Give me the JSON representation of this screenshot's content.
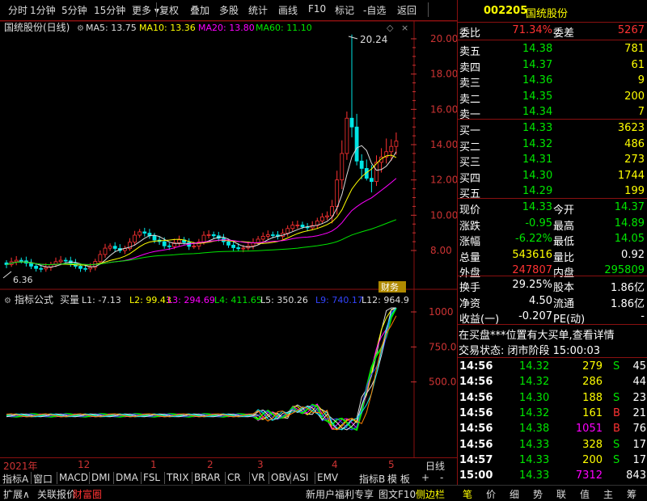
{
  "toolbar": {
    "items": [
      "分时",
      "1分钟",
      "5分钟",
      "15分钟",
      "更多",
      "复权",
      "叠加",
      "多股",
      "统计",
      "画线",
      "F10",
      "标记",
      "-自选",
      "返回"
    ]
  },
  "stock": {
    "code": "002205",
    "name": "国统股份",
    "chart_title": "国统股份(日线)"
  },
  "ma": {
    "ma5": "MA5: 13.75",
    "ma10": "MA10: 13.36",
    "ma20": "MA20: 13.80",
    "ma60": "MA60: 11.10"
  },
  "price_axis": [
    "20.00",
    "18.00",
    "16.00",
    "14.00",
    "12.00",
    "10.00",
    "8.00"
  ],
  "high_label": "20.24",
  "low_label": "6.36",
  "badge": "财务",
  "ind_badge": "模",
  "indicator": {
    "name": "指标公式",
    "formula": "买量",
    "l1": "L1: -7.13",
    "l2": "L2: 99.43",
    "l3": "L3: 294.69",
    "l4": "L4: 411.65",
    "l5": "L5: 350.26",
    "l9": "L9: 740.17",
    "l12": "L12: 964.9"
  },
  "ind_axis": [
    "1000",
    "750.0",
    "500.0"
  ],
  "time_axis": {
    "labels": [
      "2021年",
      "12",
      "1",
      "2",
      "3",
      "4",
      "5"
    ],
    "period": "日线"
  },
  "ind_tabs": [
    "指标A",
    "窗口",
    "MACD",
    "DMI",
    "DMA",
    "FSL",
    "TRIX",
    "BRAR",
    "CR",
    "VR",
    "OBV",
    "ASI",
    "EMV",
    "指标B",
    "模 板",
    "+",
    "-"
  ],
  "bottom": {
    "left": [
      "扩展∧",
      "关联报价",
      "财富圈"
    ],
    "mid": [
      "新用户福利专享",
      "图文F10",
      "侧边栏"
    ],
    "right": [
      "笔",
      "价",
      "细",
      "势",
      "联",
      "值",
      "主",
      "筹"
    ]
  },
  "quote": {
    "wb": {
      "label": "委比",
      "value": "71.34%",
      "diff_label": "委差",
      "diff": "5267"
    },
    "sells": [
      {
        "label": "卖五",
        "price": "14.38",
        "vol": "781"
      },
      {
        "label": "卖四",
        "price": "14.37",
        "vol": "61"
      },
      {
        "label": "卖三",
        "price": "14.36",
        "vol": "9"
      },
      {
        "label": "卖二",
        "price": "14.35",
        "vol": "200"
      },
      {
        "label": "卖一",
        "price": "14.34",
        "vol": "7"
      }
    ],
    "buys": [
      {
        "label": "买一",
        "price": "14.33",
        "vol": "3623"
      },
      {
        "label": "买二",
        "price": "14.32",
        "vol": "486"
      },
      {
        "label": "买三",
        "price": "14.31",
        "vol": "273"
      },
      {
        "label": "买四",
        "price": "14.30",
        "vol": "1744"
      },
      {
        "label": "买五",
        "price": "14.29",
        "vol": "199"
      }
    ],
    "stats": [
      {
        "l1": "现价",
        "v1": "14.33",
        "l2": "今开",
        "v2": "14.37"
      },
      {
        "l1": "涨跌",
        "v1": "-0.95",
        "l2": "最高",
        "v2": "14.89"
      },
      {
        "l1": "涨幅",
        "v1": "-6.22%",
        "l2": "最低",
        "v2": "14.05"
      },
      {
        "l1": "总量",
        "v1": "543616",
        "l2": "量比",
        "v2": "0.92"
      },
      {
        "l1": "外盘",
        "v1": "247807",
        "l2": "内盘",
        "v2": "295809"
      }
    ],
    "stats2": [
      {
        "l1": "换手",
        "v1": "29.25%",
        "l2": "股本",
        "v2": "1.86亿"
      },
      {
        "l1": "净资",
        "v1": "4.50",
        "l2": "流通",
        "v2": "1.86亿"
      },
      {
        "l1": "收益(一)",
        "v1": "-0.207",
        "l2": "PE(动)",
        "v2": "-"
      }
    ],
    "notice": "在买盘***位置有大买单,查看详情",
    "status": "交易状态: 闭市阶段 15:00:03",
    "ticks": [
      {
        "t": "14:56",
        "p": "14.32",
        "v": "279",
        "d": "S",
        "n": "45"
      },
      {
        "t": "14:56",
        "p": "14.32",
        "v": "286",
        "d": "",
        "n": "44"
      },
      {
        "t": "14:56",
        "p": "14.30",
        "v": "188",
        "d": "S",
        "n": "23"
      },
      {
        "t": "14:56",
        "p": "14.32",
        "v": "161",
        "d": "B",
        "n": "21"
      },
      {
        "t": "14:56",
        "p": "14.38",
        "v": "1051",
        "d": "B",
        "n": "76"
      },
      {
        "t": "14:56",
        "p": "14.33",
        "v": "328",
        "d": "S",
        "n": "17"
      },
      {
        "t": "14:57",
        "p": "14.33",
        "v": "200",
        "d": "S",
        "n": "17"
      },
      {
        "t": "15:00",
        "p": "14.33",
        "v": "7312",
        "d": "",
        "n": "843"
      }
    ]
  }
}
